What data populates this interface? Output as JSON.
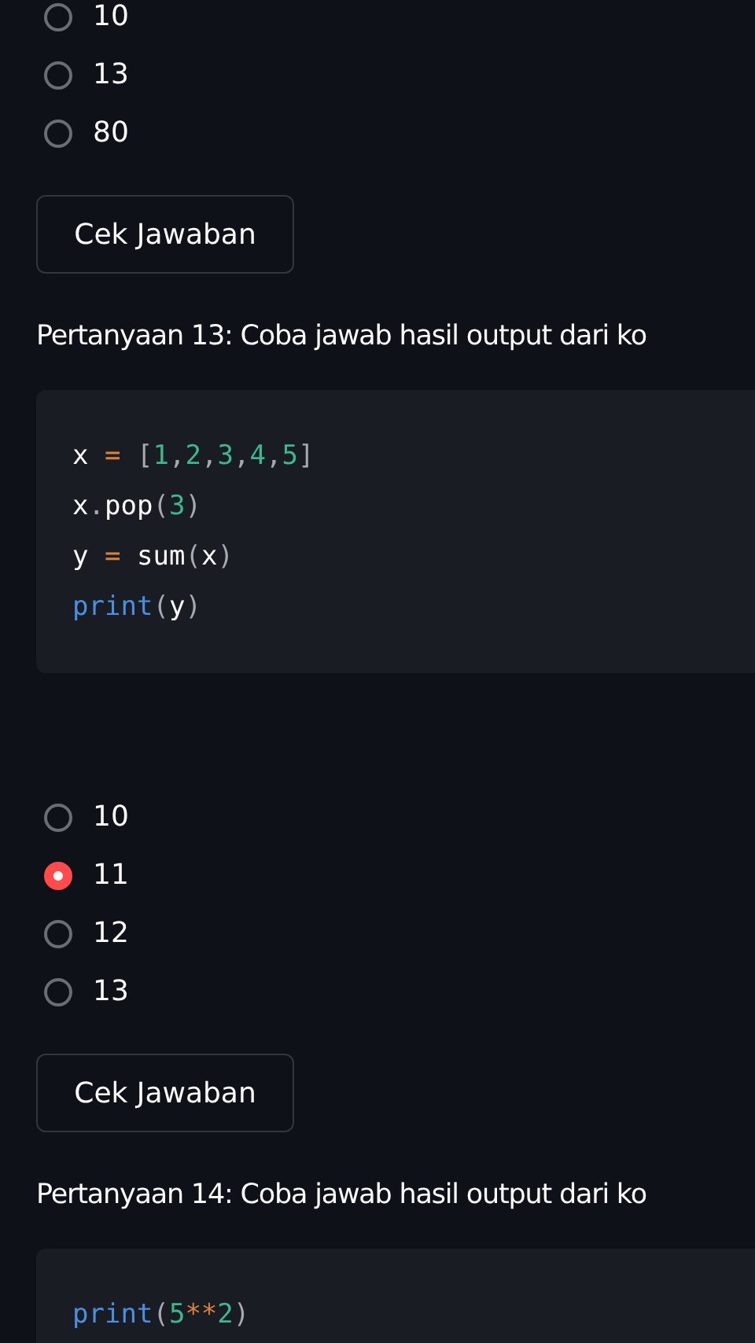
{
  "blocks": [
    {
      "kind": "radio",
      "options": [
        {
          "label": "10",
          "selected": false
        },
        {
          "label": "13",
          "selected": false
        },
        {
          "label": "80",
          "selected": false
        }
      ]
    },
    {
      "kind": "button",
      "label": "Cek Jawaban"
    },
    {
      "kind": "question",
      "text": "Pertanyaan 13: Coba jawab hasil output dari ko"
    },
    {
      "kind": "code",
      "lines": [
        [
          {
            "text": "x ",
            "kind": "name"
          },
          {
            "text": "=",
            "kind": "operator"
          },
          {
            "text": " [",
            "kind": "punct"
          },
          {
            "text": "1",
            "kind": "number"
          },
          {
            "text": ",",
            "kind": "punct"
          },
          {
            "text": "2",
            "kind": "number"
          },
          {
            "text": ",",
            "kind": "punct"
          },
          {
            "text": "3",
            "kind": "number"
          },
          {
            "text": ",",
            "kind": "punct"
          },
          {
            "text": "4",
            "kind": "number"
          },
          {
            "text": ",",
            "kind": "punct"
          },
          {
            "text": "5",
            "kind": "number"
          },
          {
            "text": "]",
            "kind": "punct"
          }
        ],
        [
          {
            "text": "x",
            "kind": "name"
          },
          {
            "text": ".",
            "kind": "punct"
          },
          {
            "text": "pop",
            "kind": "name"
          },
          {
            "text": "(",
            "kind": "punct"
          },
          {
            "text": "3",
            "kind": "number"
          },
          {
            "text": ")",
            "kind": "punct"
          }
        ],
        [
          {
            "text": "y ",
            "kind": "name"
          },
          {
            "text": "=",
            "kind": "operator"
          },
          {
            "text": " sum",
            "kind": "name"
          },
          {
            "text": "(",
            "kind": "punct"
          },
          {
            "text": "x",
            "kind": "name"
          },
          {
            "text": ")",
            "kind": "punct"
          }
        ],
        [
          {
            "text": "print",
            "kind": "builtin"
          },
          {
            "text": "(",
            "kind": "punct"
          },
          {
            "text": "y",
            "kind": "name"
          },
          {
            "text": ")",
            "kind": "punct"
          }
        ]
      ]
    },
    {
      "kind": "radio",
      "options": [
        {
          "label": "10",
          "selected": false
        },
        {
          "label": "11",
          "selected": true
        },
        {
          "label": "12",
          "selected": false
        },
        {
          "label": "13",
          "selected": false
        }
      ]
    },
    {
      "kind": "button",
      "label": "Cek Jawaban"
    },
    {
      "kind": "question",
      "text": "Pertanyaan 14: Coba jawab hasil output dari ko"
    },
    {
      "kind": "code",
      "lines": [
        [
          {
            "text": "print",
            "kind": "builtin"
          },
          {
            "text": "(",
            "kind": "punct"
          },
          {
            "text": "5",
            "kind": "number"
          },
          {
            "text": "**",
            "kind": "operator"
          },
          {
            "text": "2",
            "kind": "number"
          },
          {
            "text": ")",
            "kind": "punct"
          }
        ]
      ]
    }
  ]
}
